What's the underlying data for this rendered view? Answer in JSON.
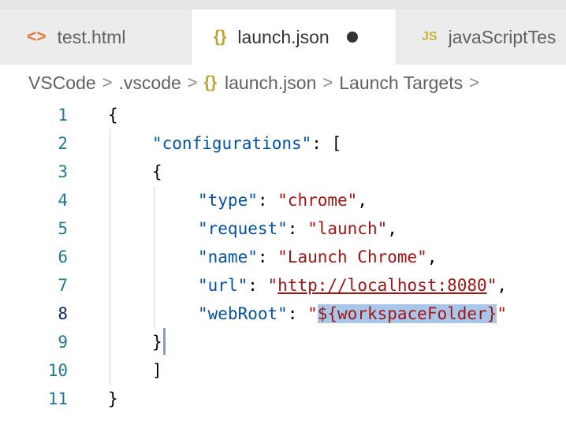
{
  "tabs": [
    {
      "icon": "<>",
      "label": "test.html",
      "active": false
    },
    {
      "icon": "{}",
      "label": "launch.json",
      "active": true,
      "dirty": true
    },
    {
      "icon": "JS",
      "label": "javaScriptTes",
      "active": false
    }
  ],
  "breadcrumb": {
    "items": [
      "VSCode",
      ".vscode",
      "launch.json",
      "Launch Targets"
    ],
    "separator": ">",
    "json_icon": "{}"
  },
  "editor": {
    "current_line": 8,
    "line_numbers": [
      "1",
      "2",
      "3",
      "4",
      "5",
      "6",
      "7",
      "8",
      "9",
      "10",
      "11"
    ],
    "tokens": {
      "l1_open": "{",
      "l2_key": "\"configurations\"",
      "l2_rest": ": [",
      "l3_open": "{",
      "l4_key": "\"type\"",
      "l4_colon": ": ",
      "l4_val": "\"chrome\"",
      "l4_comma": ",",
      "l5_key": "\"request\"",
      "l5_colon": ": ",
      "l5_val": "\"launch\"",
      "l5_comma": ",",
      "l6_key": "\"name\"",
      "l6_colon": ": ",
      "l6_val": "\"Launch Chrome\"",
      "l6_comma": ",",
      "l7_key": "\"url\"",
      "l7_colon": ": ",
      "l7_q1": "\"",
      "l7_link": "http://localhost:8080",
      "l7_q2": "\"",
      "l7_comma": ",",
      "l8_key": "\"webRoot\"",
      "l8_colon": ": ",
      "l8_q1": "\"",
      "l8_sel": "${workspaceFolder}",
      "l8_q2": "\"",
      "l9_close": "}",
      "l10_close": "]",
      "l11_close": "}"
    }
  },
  "colors": {
    "key": "#0451a5",
    "string": "#a31515",
    "line_number": "#237893",
    "selection": "#a8c7e8"
  }
}
